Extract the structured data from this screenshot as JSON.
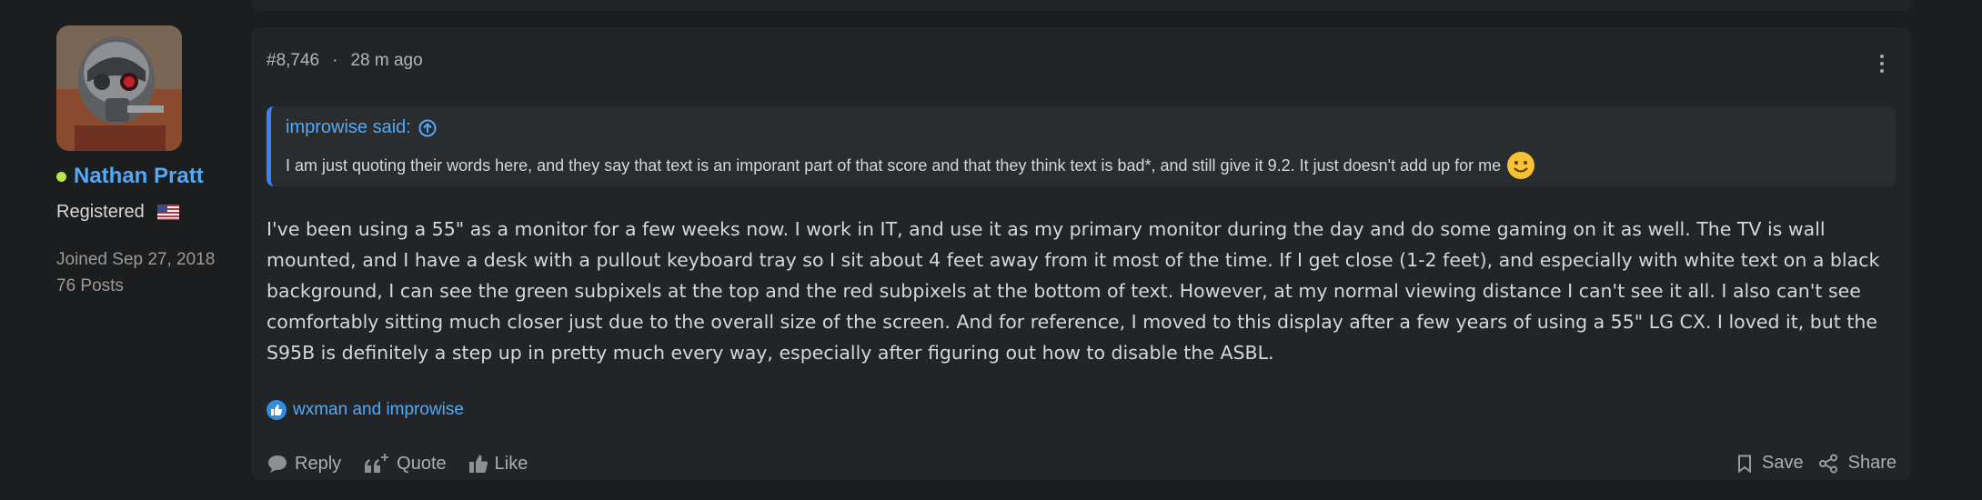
{
  "author": {
    "name": "Nathan Pratt",
    "role": "Registered",
    "joined": "Joined Sep 27, 2018",
    "posts": "76 Posts"
  },
  "post": {
    "number": "#8,746",
    "separator": "·",
    "time": "28 m ago",
    "quote": {
      "author": "improwise said:",
      "text": "I am just quoting their words here, and they say that text is an imporant part of that score and that they think text is bad*, and still give it 9.2. It just doesn't add up for me"
    },
    "body": "I've been using a 55\" as a monitor for a few weeks now. I work in IT, and use it as my primary monitor during the day and do some gaming on it as well. The TV is wall mounted, and I have a desk with a pullout keyboard tray so I sit about 4 feet away from it most of the time. If I get close (1-2 feet), and especially with white text on a black background, I can see the green subpixels at the top and the red subpixels at the bottom of text. However, at my normal viewing distance I can't see it all. I also can't see comfortably sitting much closer just due to the overall size of the screen. And for reference, I moved to this display after a few years of using a 55\" LG CX. I loved it, but the S95B is definitely a step up in pretty much every way, especially after figuring out how to disable the ASBL.",
    "reactions": "wxman and improwise"
  },
  "actions": {
    "reply": "Reply",
    "quote": "Quote",
    "like": "Like",
    "save": "Save",
    "share": "Share"
  },
  "icons": {
    "online": "online-dot",
    "flag": "us-flag-icon",
    "more": "more-vertical-icon",
    "quote_link": "arrow-up-circle-icon",
    "emoji": "smile-emoji-icon",
    "like_badge": "thumbs-up-icon",
    "reply": "speech-bubble-icon",
    "quote": "quote-plus-icon",
    "like": "thumbs-up-icon",
    "save": "bookmark-icon",
    "share": "share-icon"
  },
  "colors": {
    "background": "#1b1d1f",
    "card": "#222527",
    "accent": "#55a8f6",
    "online": "#b5e853"
  }
}
